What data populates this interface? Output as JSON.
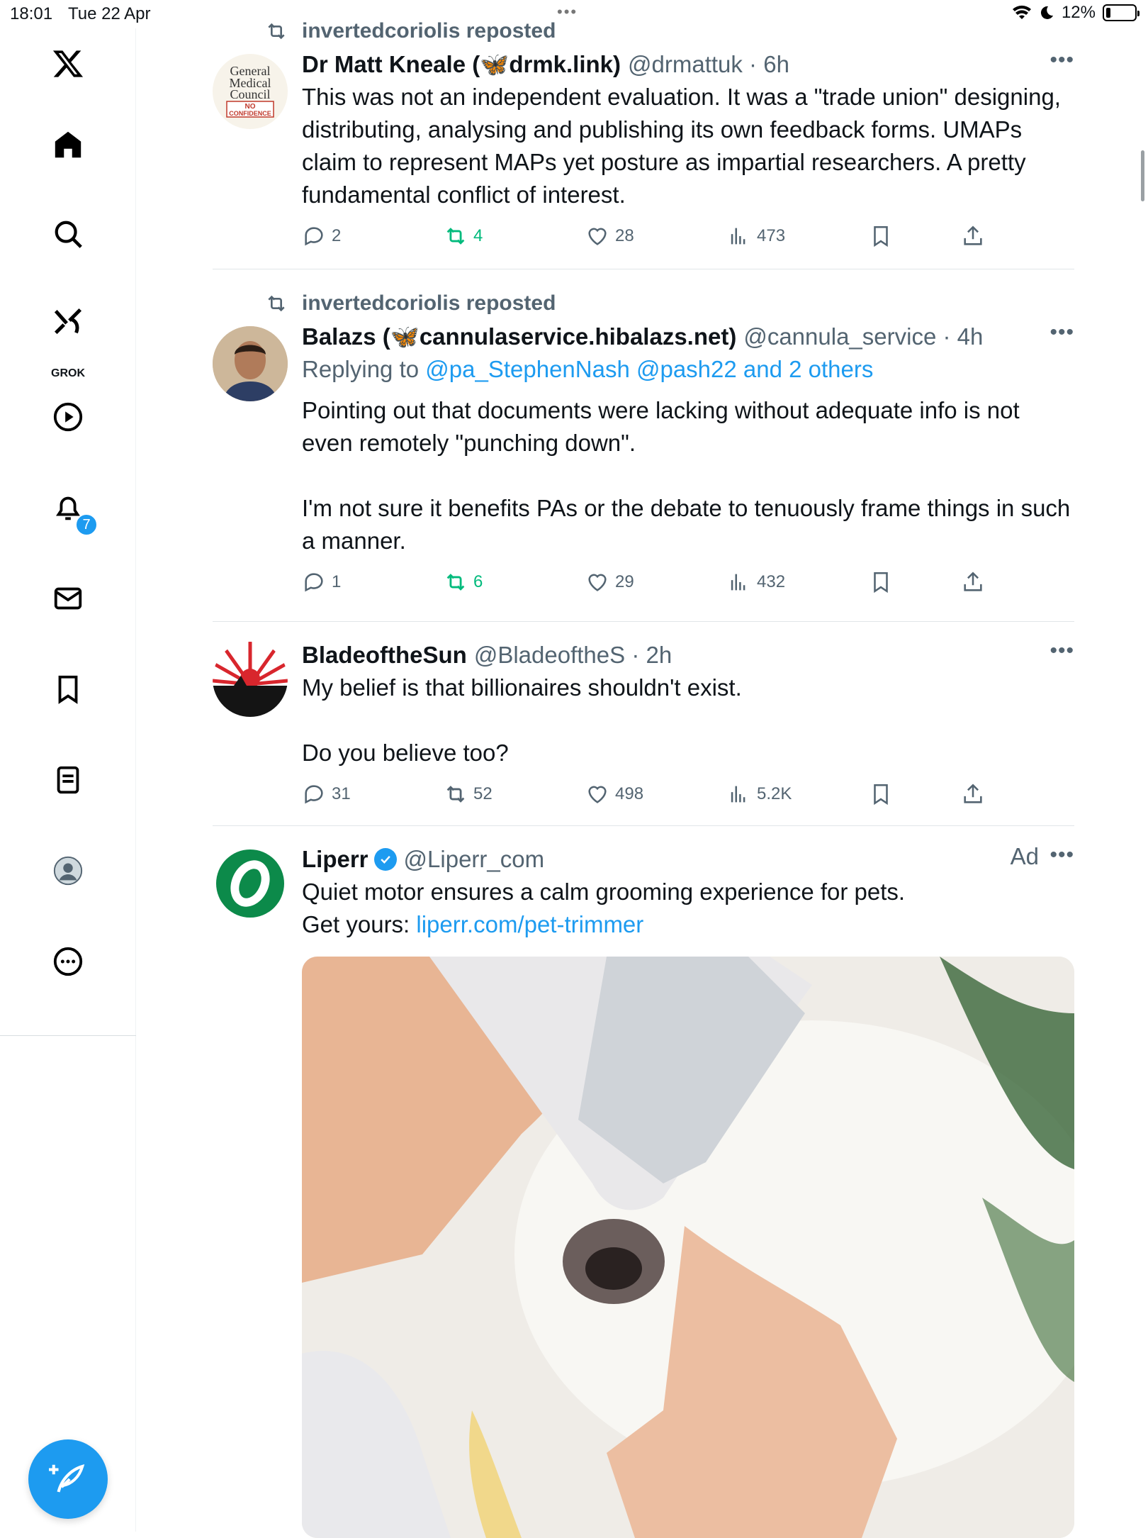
{
  "status_bar": {
    "time": "18:01",
    "date": "Tue 22 Apr",
    "battery": "12%"
  },
  "sidebar": {
    "items": [
      {
        "name": "x-logo"
      },
      {
        "name": "home"
      },
      {
        "name": "explore"
      },
      {
        "name": "grok",
        "label": "GROK"
      },
      {
        "name": "video"
      },
      {
        "name": "notifications",
        "badge": "7"
      },
      {
        "name": "messages"
      },
      {
        "name": "bookmarks"
      },
      {
        "name": "lists"
      },
      {
        "name": "profile"
      },
      {
        "name": "more"
      }
    ]
  },
  "tweets": [
    {
      "repost_by": "invertedcoriolis reposted",
      "name": "Dr Matt Kneale (",
      "name_suffix": "drmk.link)",
      "handle": "@drmattuk · 6h",
      "text": "This was not an independent evaluation. It was a \"trade union\" designing, distributing, analysing and publishing its own feedback forms. UMAPs claim to represent MAPs yet posture as impartial researchers. A pretty fundamental conflict of interest.",
      "stats": {
        "replies": "2",
        "reposts": "4",
        "likes": "28",
        "views": "473"
      },
      "avatar_text": {
        "l1": "General",
        "l2": "Medical",
        "l3": "Council",
        "l4": "NO",
        "l5": "CONFIDENCE"
      }
    },
    {
      "repost_by": "invertedcoriolis reposted",
      "name": "Balazs (",
      "name_suffix": "cannulaservice.hibalazs.net)",
      "handle": "@cannula_service · 4h",
      "reply_prefix": "Replying to ",
      "reply_to": "@pa_StephenNash @pash22 and 2 others",
      "text": "Pointing out that documents were lacking without adequate info is not even remotely \"punching down\".\n\nI'm not sure it benefits PAs or the debate to tenuously frame things in such a manner.",
      "stats": {
        "replies": "1",
        "reposts": "6",
        "likes": "29",
        "views": "432"
      }
    },
    {
      "name": "BladeoftheSun",
      "handle": "@BladeoftheS · 2h",
      "text": "My belief is that billionaires shouldn't exist.\n\nDo you believe too?",
      "stats": {
        "replies": "31",
        "reposts": "52",
        "likes": "498",
        "views": "5.2K"
      }
    },
    {
      "name": "Liperr",
      "handle": "@Liperr_com",
      "ad_label": "Ad",
      "text": "Quiet motor ensures a calm grooming experience for pets.",
      "text2_prefix": "Get yours: ",
      "link": "liperr.com/pet-trimmer"
    }
  ],
  "colors": {
    "accent": "#1d9bf0",
    "repost_green": "#00ba7c",
    "secondary": "#536471"
  }
}
